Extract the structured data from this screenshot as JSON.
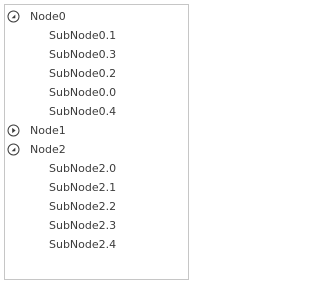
{
  "tree": {
    "nodes": [
      {
        "label": "Node0",
        "expanded": true,
        "children": [
          "SubNode0.1",
          "SubNode0.3",
          "SubNode0.2",
          "SubNode0.0",
          "SubNode0.4"
        ]
      },
      {
        "label": "Node1",
        "expanded": false,
        "children": []
      },
      {
        "label": "Node2",
        "expanded": true,
        "children": [
          "SubNode2.0",
          "SubNode2.1",
          "SubNode2.2",
          "SubNode2.3",
          "SubNode2.4"
        ]
      }
    ]
  },
  "colors": {
    "text": "#3c3c3c",
    "border": "#c6c6c6",
    "icon": "#3c3c3c"
  },
  "icons": {
    "expanded": "circle-chevron-down-icon",
    "collapsed": "circle-chevron-right-icon"
  }
}
